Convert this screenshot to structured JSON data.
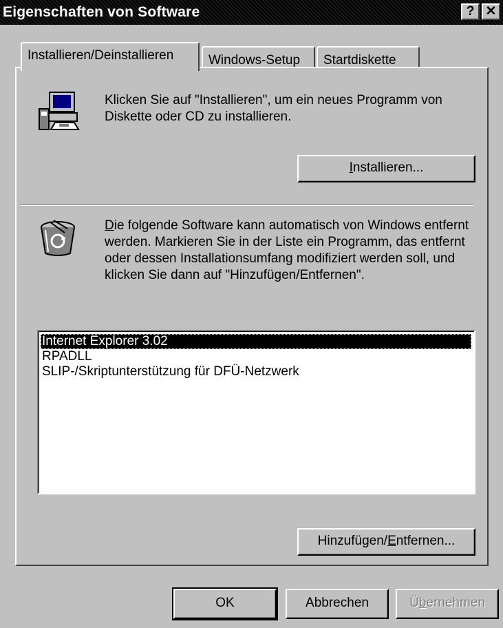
{
  "window": {
    "title": "Eigenschaften von Software",
    "help_glyph": "?",
    "close_glyph": "✕"
  },
  "tabs": [
    {
      "label": "Installieren/Deinstallieren",
      "active": true
    },
    {
      "label": "Windows-Setup",
      "active": false
    },
    {
      "label": "Startdiskette",
      "active": false
    }
  ],
  "install_section": {
    "icon": "computer-disk-icon",
    "description": "Klicken Sie auf \"Installieren\", um ein neues Programm von Diskette oder CD zu installieren.",
    "button": {
      "mnemonic": "I",
      "rest": "nstallieren..."
    }
  },
  "remove_section": {
    "icon": "recycle-bin-icon",
    "description_mnemonic": "D",
    "description_rest": "ie folgende Software kann automatisch von Windows entfernt werden. Markieren Sie in der Liste ein Programm, das entfernt oder dessen Installationsumfang modifiziert werden soll, und klicken Sie dann auf \"Hinzufügen/Entfernen\".",
    "programs": [
      "Internet Explorer 3.02",
      "RPADLL",
      "SLIP-/Skriptunterstützung für DFÜ-Netzwerk"
    ],
    "selected_index": 0,
    "button": {
      "before": "Hinzufügen/",
      "mnemonic": "E",
      "after": "ntfernen..."
    }
  },
  "footer": {
    "ok": "OK",
    "cancel": "Abbrechen",
    "apply": {
      "before": "Ü",
      "mnemonic": "b",
      "after": "ernehmen",
      "disabled": true
    }
  },
  "colors": {
    "face": "#c0c0c0",
    "title_bg": "#000000",
    "selection": "#000000"
  }
}
